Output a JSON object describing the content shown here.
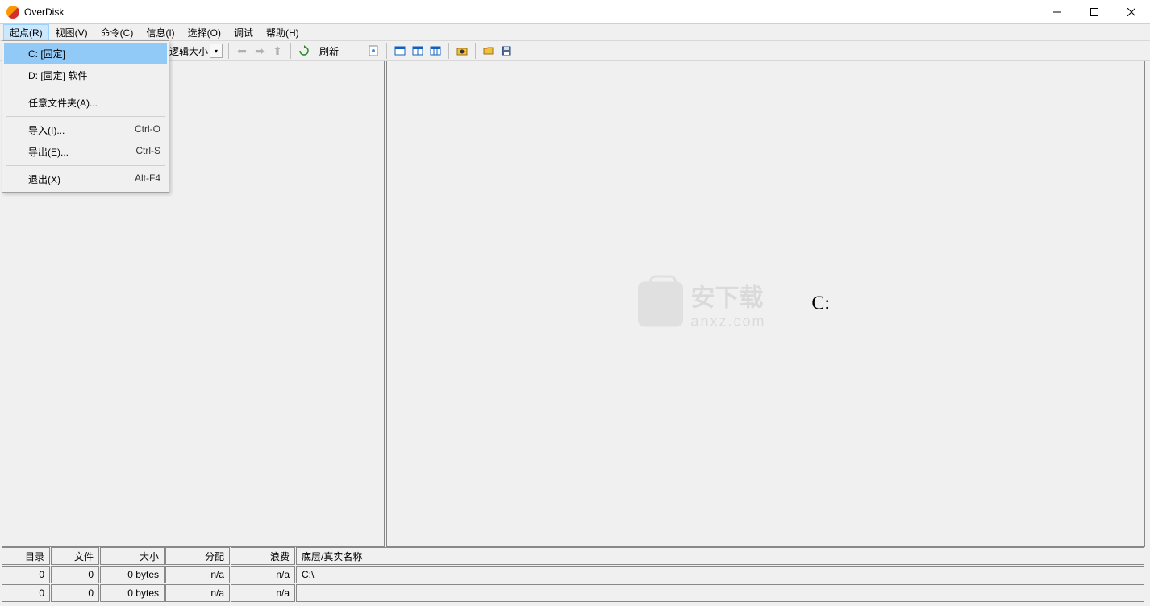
{
  "window": {
    "title": "OverDisk"
  },
  "menu": {
    "items": [
      "起点(R)",
      "视图(V)",
      "命令(C)",
      "信息(I)",
      "选择(O)",
      "调试",
      "帮助(H)"
    ],
    "active_index": 0
  },
  "dropdown": {
    "items": [
      {
        "label": "C: [固定]",
        "shortcut": "",
        "highlighted": true
      },
      {
        "label": "D: [固定] 软件",
        "shortcut": ""
      },
      {
        "sep": true
      },
      {
        "label": "任意文件夹(A)...",
        "shortcut": ""
      },
      {
        "sep": true
      },
      {
        "label": "导入(I)...",
        "shortcut": "Ctrl-O"
      },
      {
        "label": "导出(E)...",
        "shortcut": "Ctrl-S"
      },
      {
        "sep": true
      },
      {
        "label": "退出(X)",
        "shortcut": "Alt-F4"
      }
    ]
  },
  "toolbar": {
    "combo_label": "逻辑大小",
    "refresh_label": "刷新"
  },
  "main": {
    "drive_label": "C:",
    "watermark_cn": "安下载",
    "watermark_en": "anxz.com"
  },
  "bottom": {
    "headers": {
      "dir": "目录",
      "file": "文件",
      "size": "大小",
      "alloc": "分配",
      "waste": "浪费",
      "path": "底层/真实名称"
    },
    "rows": [
      {
        "dir": "0",
        "file": "0",
        "size": "0 bytes",
        "alloc": "n/a",
        "waste": "n/a",
        "path": "C:\\"
      },
      {
        "dir": "0",
        "file": "0",
        "size": "0 bytes",
        "alloc": "n/a",
        "waste": "n/a",
        "path": ""
      }
    ]
  }
}
